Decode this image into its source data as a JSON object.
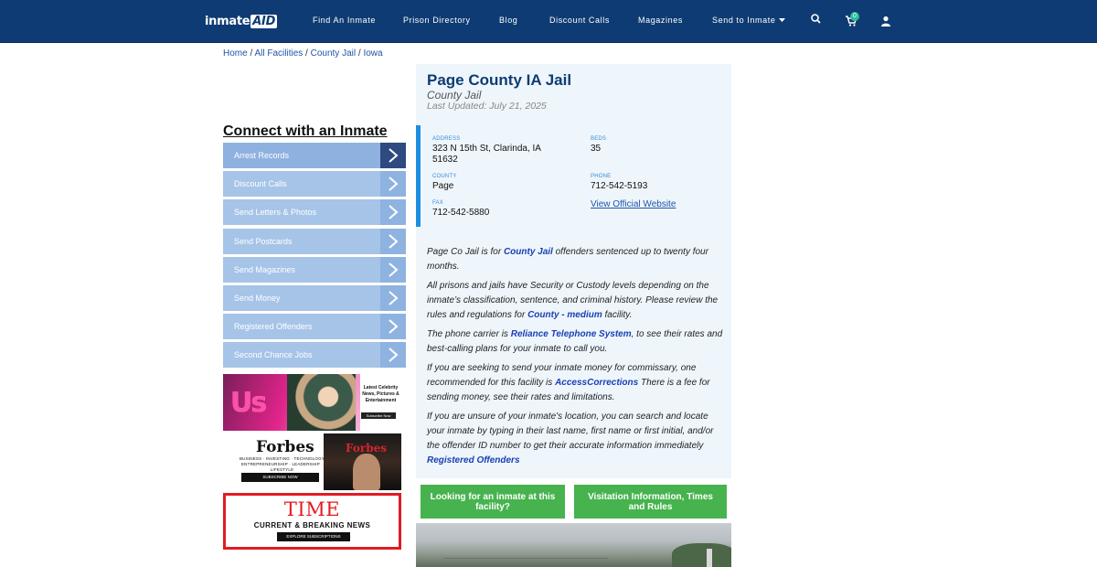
{
  "nav": {
    "logo_main": "inmate",
    "logo_accent": "AID",
    "links": [
      {
        "label": "Find An Inmate"
      },
      {
        "label": "Prison Directory"
      },
      {
        "label": "Blog"
      },
      {
        "label": "Discount Calls"
      },
      {
        "label": "Magazines"
      },
      {
        "label": "Send to Inmate"
      }
    ],
    "cart_count": "0",
    "icons": [
      "search-icon",
      "cart-icon",
      "user-icon",
      "caret-down-icon"
    ]
  },
  "breadcrumb": {
    "home": "Home",
    "sep": " / ",
    "all": "All Facilities",
    "type": "County Jail",
    "state": "Iowa"
  },
  "sidebar": {
    "title": "Connect with an Inmate",
    "items": [
      {
        "label": "Arrest Records"
      },
      {
        "label": "Discount Calls"
      },
      {
        "label": "Send Letters & Photos"
      },
      {
        "label": "Send Postcards"
      },
      {
        "label": "Send Magazines"
      },
      {
        "label": "Send Money"
      },
      {
        "label": "Registered Offenders"
      },
      {
        "label": "Second Chance Jobs"
      }
    ]
  },
  "ads": {
    "us": {
      "logo": "Us",
      "text": "Latest Celebrity News, Pictures & Entertainment",
      "button": "Subscribe Now"
    },
    "forbes": {
      "logo": "Forbes",
      "tagline": "BUSINESS · INVESTING · TECHNOLOGY ENTREPRENEURSHIP · LEADERSHIP · LIFESTYLE",
      "button": "SUBSCRIBE NOW",
      "cover_logo": "Forbes"
    },
    "time": {
      "logo": "TIME",
      "subtitle": "CURRENT & BREAKING NEWS",
      "button": "EXPLORE SUBSCRIPTIONS"
    }
  },
  "facility": {
    "title": "Page County IA Jail",
    "type": "County Jail",
    "updated": "Last Updated: July 21, 2025",
    "info": {
      "address_label": "ADDRESS",
      "address_line1": "323 N 15th St, Clarinda, IA",
      "address_line2": "51632",
      "beds_label": "BEDS",
      "beds": "35",
      "county_label": "COUNTY",
      "county": "Page",
      "phone_label": "PHONE",
      "phone": "712-542-5193",
      "fax_label": "FAX",
      "fax": "712-542-5880",
      "website_link": "View Official Website"
    },
    "desc": {
      "p1_a": "Page Co Jail is for ",
      "p1_link": "County Jail",
      "p1_b": " offenders sentenced up to twenty four months.",
      "p2_a": "All prisons and jails have Security or Custody levels depending on the inmate’s classification, sentence, and criminal history. Please review the rules and regulations for ",
      "p2_link": "County - medium",
      "p2_b": " facility.",
      "p3_a": "The phone carrier is ",
      "p3_link": "Reliance Telephone System",
      "p3_b": ", to see their rates and best-calling plans for your inmate to call you.",
      "p4_a": "If you are seeking to send your inmate money for commissary, one recommended for this facility is ",
      "p4_link": "AccessCorrections",
      "p4_b": " There is a fee for sending money, see their rates and limitations.",
      "p5_a": "If you are unsure of your inmate's location, you can search and locate your inmate by typing in their last name, first name or first initial, and/or the offender ID number to get their accurate information immediately ",
      "p5_link": "Registered Offenders"
    },
    "buttons": {
      "look": "Looking for an inmate at this facility?",
      "visit": "Visitation Information, Times and Rules"
    }
  }
}
